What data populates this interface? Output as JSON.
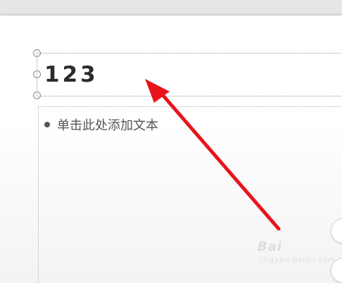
{
  "slide": {
    "title_text": "123",
    "content_placeholder": "单击此处添加文本"
  },
  "annotation": {
    "arrow_color": "#e8141b"
  },
  "watermark": {
    "logo_text": "Bai",
    "sub_text": "jingyan.baidu.com"
  }
}
